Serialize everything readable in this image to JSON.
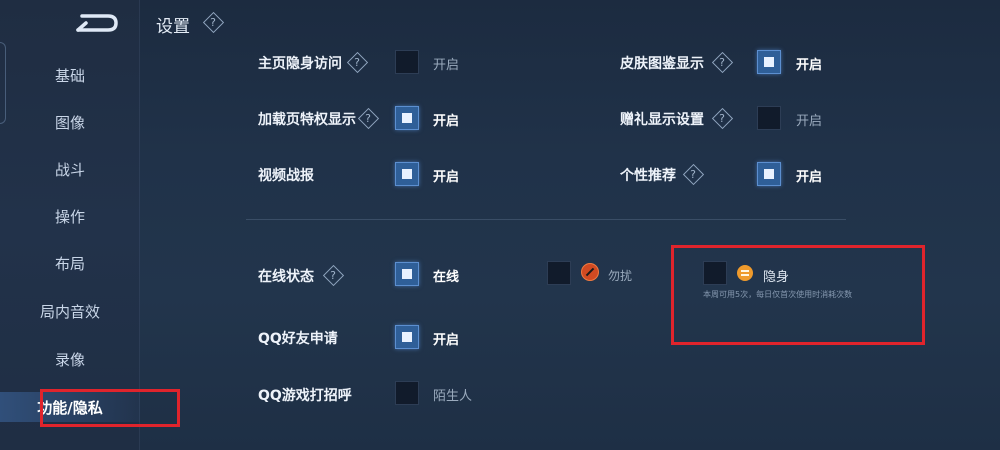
{
  "header": {
    "title": "设置"
  },
  "sidebar": {
    "back_icon": "back-arrow-icon",
    "items": [
      {
        "label": "基础"
      },
      {
        "label": "图像"
      },
      {
        "label": "战斗"
      },
      {
        "label": "操作"
      },
      {
        "label": "布局"
      },
      {
        "label": "局内音效"
      },
      {
        "label": "录像"
      },
      {
        "label": "功能/隐私",
        "active": true
      }
    ]
  },
  "settings": {
    "homepage_privacy": {
      "label": "主页隐身访问",
      "value": "开启",
      "checked": false
    },
    "skin_gallery": {
      "label": "皮肤图鉴显示",
      "value": "开启",
      "checked": true
    },
    "loading_privilege": {
      "label": "加载页特权显示",
      "value": "开启",
      "checked": true
    },
    "gift_display": {
      "label": "赠礼显示设置",
      "value": "开启",
      "checked": false
    },
    "video_report": {
      "label": "视频战报",
      "value": "开启",
      "checked": true
    },
    "personal_recommend": {
      "label": "个性推荐",
      "value": "开启",
      "checked": true
    },
    "online_status": {
      "label": "在线状态",
      "online": {
        "value": "在线",
        "checked": true
      },
      "dnd": {
        "value": "勿扰",
        "checked": false
      },
      "invisible": {
        "value": "隐身",
        "checked": false,
        "note": "本周可用5次，每日仅首次使用时消耗次数"
      }
    },
    "qq_friend_request": {
      "label": "QQ好友申请",
      "value": "开启",
      "checked": true
    },
    "qq_game_greeting": {
      "label": "QQ游戏打招呼",
      "value": "陌生人",
      "checked": false
    }
  },
  "colors": {
    "highlight": "#e0242c",
    "accent": "#2f5f98"
  }
}
